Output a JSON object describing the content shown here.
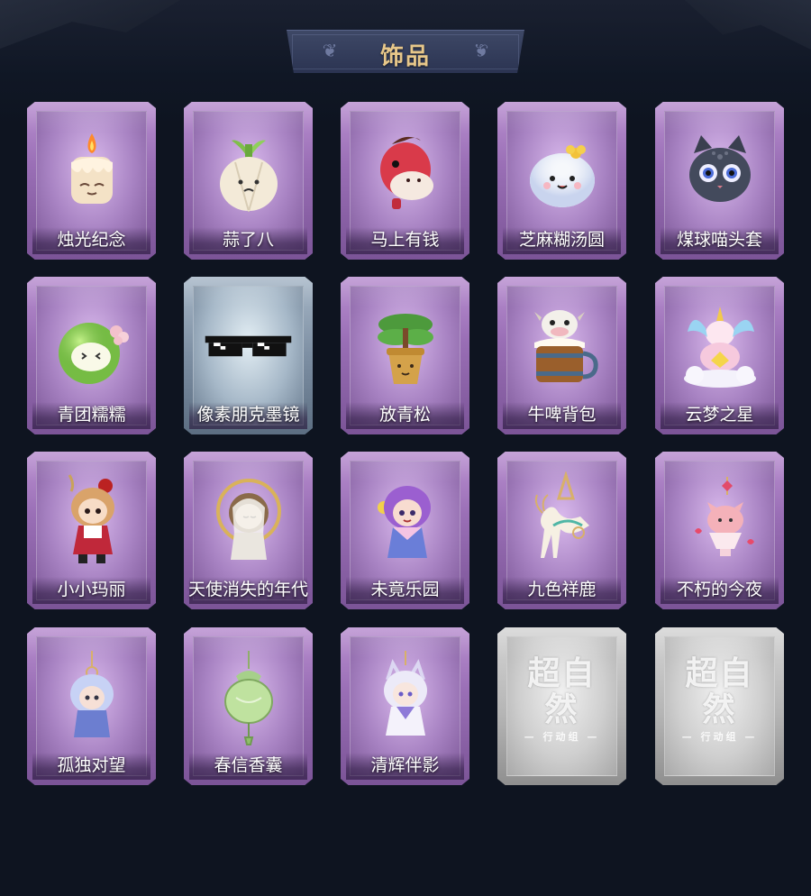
{
  "header": {
    "title": "饰品"
  },
  "items": [
    {
      "name": "烛光纪念",
      "icon": "candle-icon",
      "theme": "purple"
    },
    {
      "name": "蒜了八",
      "icon": "garlic-icon",
      "theme": "purple"
    },
    {
      "name": "马上有钱",
      "icon": "red-horse-icon",
      "theme": "purple"
    },
    {
      "name": "芝麻糊汤圆",
      "icon": "rice-ball-icon",
      "theme": "purple"
    },
    {
      "name": "煤球喵头套",
      "icon": "black-cat-head-icon",
      "theme": "purple"
    },
    {
      "name": "青团糯糯",
      "icon": "green-rice-ball-icon",
      "theme": "purple"
    },
    {
      "name": "像素朋克墨镜",
      "icon": "pixel-sunglasses-icon",
      "theme": "blue"
    },
    {
      "name": "放青松",
      "icon": "potted-pine-icon",
      "theme": "purple"
    },
    {
      "name": "牛啤背包",
      "icon": "cow-beer-mug-icon",
      "theme": "purple"
    },
    {
      "name": "云梦之星",
      "icon": "unicorn-cloud-icon",
      "theme": "purple"
    },
    {
      "name": "小小玛丽",
      "icon": "mary-doll-icon",
      "theme": "purple"
    },
    {
      "name": "天使消失的年代",
      "icon": "angel-doll-icon",
      "theme": "purple"
    },
    {
      "name": "未竟乐园",
      "icon": "jester-doll-icon",
      "theme": "purple"
    },
    {
      "name": "九色祥鹿",
      "icon": "deer-charm-icon",
      "theme": "purple"
    },
    {
      "name": "不朽的今夜",
      "icon": "pink-cat-cup-icon",
      "theme": "purple"
    },
    {
      "name": "孤独对望",
      "icon": "blue-doll-charm-icon",
      "theme": "purple"
    },
    {
      "name": "春信香囊",
      "icon": "sachet-icon",
      "theme": "purple"
    },
    {
      "name": "清辉伴影",
      "icon": "white-doll-charm-icon",
      "theme": "purple"
    },
    {
      "name": "",
      "icon": "logo-placeholder-icon",
      "theme": "grey",
      "watermark": "超自然",
      "watermark_sub": "— 行动组 —"
    },
    {
      "name": "",
      "icon": "logo-placeholder-icon",
      "theme": "grey",
      "watermark": "超自然",
      "watermark_sub": "— 行动组 —"
    }
  ]
}
